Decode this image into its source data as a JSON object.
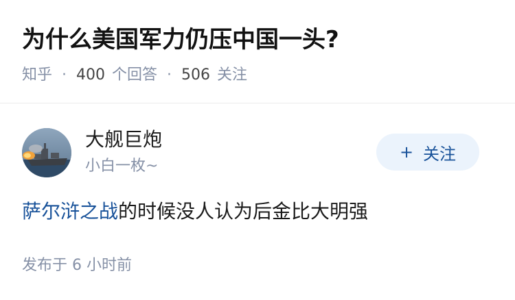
{
  "question": {
    "title": "为什么美国军力仍压中国一头?",
    "source": "知乎",
    "answer_count": "400",
    "answer_label": "个回答",
    "follower_count": "506",
    "follower_label": "关注",
    "separator": "·"
  },
  "answer": {
    "author": {
      "name": "大舰巨炮",
      "bio": "小白一枚~",
      "avatar_icon": "battleship-avatar"
    },
    "follow_button": {
      "plus": "+",
      "label": "关注"
    },
    "content": {
      "link_text": "萨尔浒之战",
      "text": "的时候没人认为后金比大明强"
    },
    "publish_time": "发布于 6 小时前"
  },
  "colors": {
    "link": "#175199",
    "muted": "#8590a6",
    "button_bg": "#ebf3fc"
  }
}
